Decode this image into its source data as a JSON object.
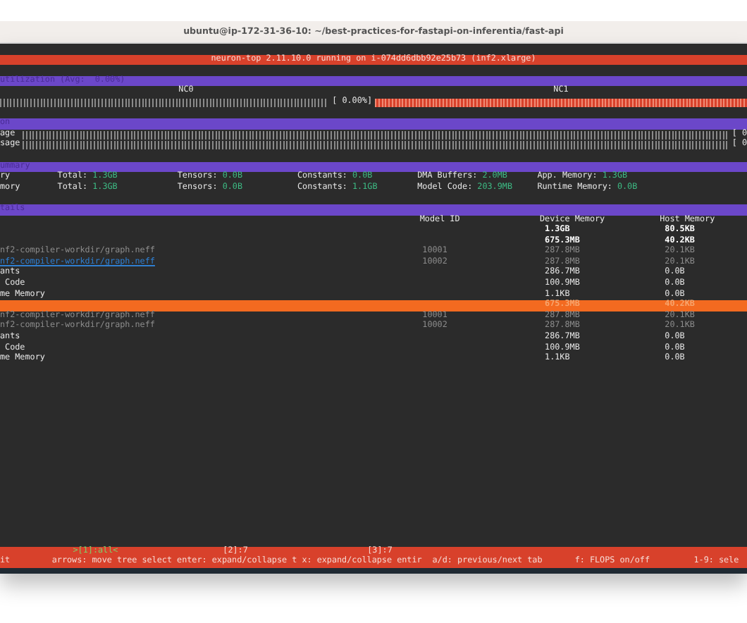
{
  "window": {
    "title": "ubuntu@ip-172-31-36-10: ~/best-practices-for-fastapi-on-inferentia/fast-api"
  },
  "header": "neuron-top 2.11.10.0 running on i-074dd6dbb92e25b73 (inf2.xlarge)",
  "utilization": {
    "title": "utilization (Avg:  0.00%)",
    "cores": [
      {
        "name": "NC0",
        "level": 0,
        "reading": "[ 0.00%]",
        "selected": false
      },
      {
        "name": "NC1",
        "level": 0,
        "selected": true
      }
    ]
  },
  "usage": {
    "title": "on",
    "rows": [
      {
        "label": "age",
        "level": 0,
        "reading": "[ 0"
      },
      {
        "label": "sage",
        "level": 0,
        "reading": "[ 0"
      }
    ]
  },
  "memory_summary": {
    "title": "ummary",
    "rows": [
      {
        "label": "ry",
        "fields": [
          {
            "label": "Total:",
            "value": "1.3GB"
          },
          {
            "label": "Tensors:",
            "value": "0.0B"
          },
          {
            "label": "Constants:",
            "value": "0.0B"
          },
          {
            "label": "DMA Buffers:",
            "value": "2.0MB"
          },
          {
            "label": "App. Memory:",
            "value": "1.3GB"
          }
        ]
      },
      {
        "label": "mory",
        "fields": [
          {
            "label": "Total:",
            "value": "1.3GB"
          },
          {
            "label": "Tensors:",
            "value": "0.0B"
          },
          {
            "label": "Constants:",
            "value": "1.1GB"
          },
          {
            "label": "Model Code:",
            "value": "203.9MB"
          },
          {
            "label": "Runtime Memory:",
            "value": "0.0B"
          }
        ]
      }
    ]
  },
  "details": {
    "title": "tails",
    "columns": [
      "Model ID",
      "Device Memory",
      "Host Memory"
    ],
    "rows": [
      {
        "kind": "total",
        "device": "1.3GB",
        "host": "80.5KB",
        "selected": false
      },
      {
        "kind": "total",
        "device": "675.3MB",
        "host": "40.2KB",
        "selected": false
      },
      {
        "kind": "model",
        "name": "nf2-compiler-workdir/graph.neff",
        "model_id": "10001",
        "device": "287.8MB",
        "host": "20.1KB",
        "selected": false
      },
      {
        "kind": "model-link",
        "name": "nf2-compiler-workdir/graph.neff",
        "model_id": "10002",
        "device": "287.8MB",
        "host": "20.1KB",
        "selected": false
      },
      {
        "kind": "entry",
        "name": "ants",
        "device": "286.7MB",
        "host": "0.0B",
        "selected": false
      },
      {
        "kind": "entry",
        "name": " Code",
        "device": "100.9MB",
        "host": "0.0B",
        "selected": false
      },
      {
        "kind": "entry",
        "name": "me Memory",
        "device": "1.1KB",
        "host": "0.0B",
        "selected": false
      },
      {
        "kind": "total",
        "device": "675.3MB",
        "host": "40.2KB",
        "selected": true
      },
      {
        "kind": "model",
        "name": "nf2-compiler-workdir/graph.neff",
        "model_id": "10001",
        "device": "287.8MB",
        "host": "20.1KB",
        "selected": false
      },
      {
        "kind": "model",
        "name": "nf2-compiler-workdir/graph.neff",
        "model_id": "10002",
        "device": "287.8MB",
        "host": "20.1KB",
        "selected": false
      },
      {
        "kind": "entry",
        "name": "ants",
        "device": "286.7MB",
        "host": "0.0B",
        "selected": false
      },
      {
        "kind": "entry",
        "name": " Code",
        "device": "100.9MB",
        "host": "0.0B",
        "selected": false
      },
      {
        "kind": "entry",
        "name": "me Memory",
        "device": "1.1KB",
        "host": "0.0B",
        "selected": false
      }
    ]
  },
  "footer": {
    "tabs": [
      {
        "label": ">[1]:all<",
        "selected": true
      },
      {
        "label": "[2]:7",
        "selected": false
      },
      {
        "label": "[3]:7",
        "selected": false
      }
    ],
    "hints": [
      "it",
      "arrows: move tree select",
      "enter: expand/collapse t",
      "x: expand/collapse entir",
      "a/d: previous/next tab",
      "f: FLOPS on/off",
      "1-9: sele"
    ]
  }
}
